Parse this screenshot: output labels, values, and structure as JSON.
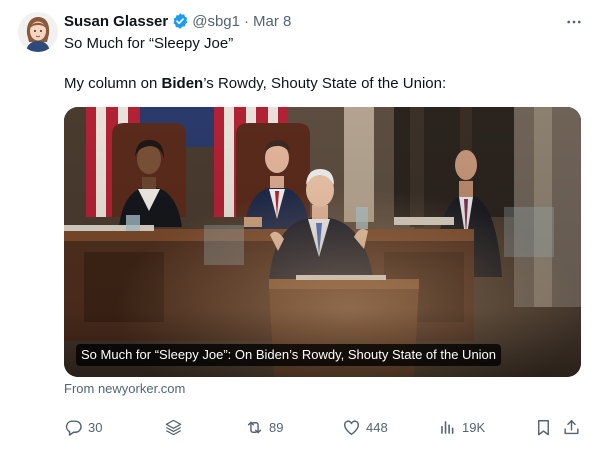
{
  "author": {
    "display_name": "Susan Glasser",
    "handle": "@sbg1",
    "separator": "·",
    "date": "Mar 8"
  },
  "tweet": {
    "line1": "So Much for “Sleepy Joe”",
    "line2_before": "My column on ",
    "line2_bold": "Biden",
    "line2_after": "’s Rowdy, Shouty State of the Union:"
  },
  "card": {
    "caption": "So Much for “Sleepy Joe”: On Biden’s Rowdy, Shouty State of the Union",
    "source": "From newyorker.com"
  },
  "actions": {
    "replies": "30",
    "reposts": "89",
    "likes": "448",
    "views": "19K"
  },
  "colors": {
    "text": "#0f1419",
    "secondary": "#536471",
    "verified_badge": "#1d9bf0"
  },
  "icons": [
    "verified-badge-icon",
    "more-options-icon",
    "reply-icon",
    "grok-icon",
    "repost-icon",
    "like-icon",
    "views-icon",
    "bookmark-icon",
    "share-icon"
  ]
}
